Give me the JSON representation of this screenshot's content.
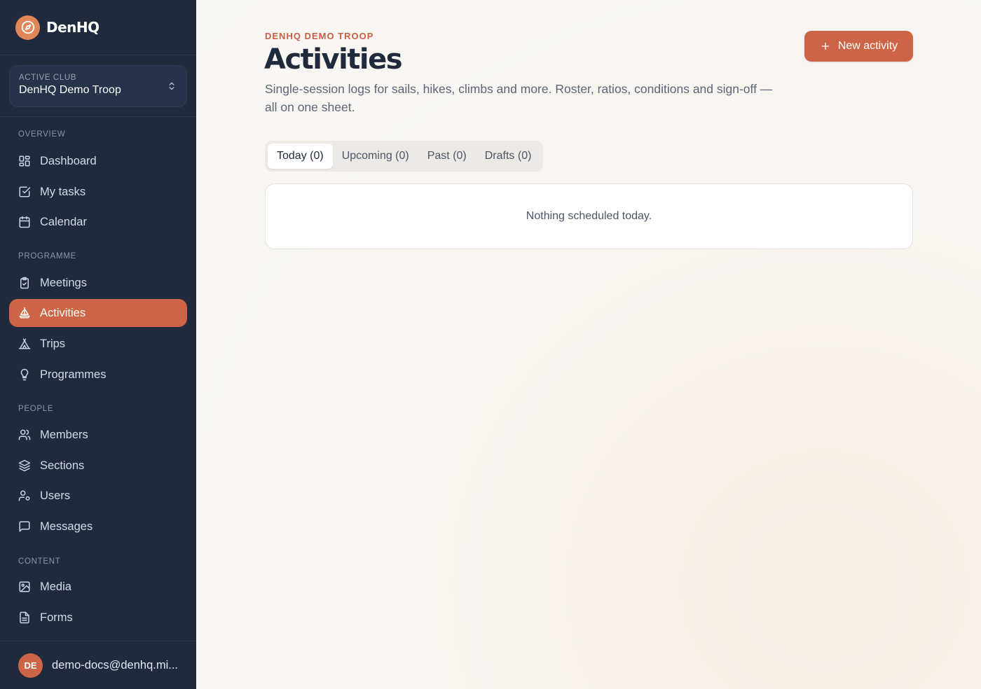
{
  "brand": {
    "name": "DenHQ",
    "logo_icon": "compass-icon",
    "accent": "#e0875a"
  },
  "club_switcher": {
    "label": "ACTIVE CLUB",
    "name": "DenHQ Demo Troop"
  },
  "sidebar": {
    "sections": [
      {
        "label": "OVERVIEW",
        "items": [
          {
            "label": "Dashboard",
            "icon": "dashboard-icon"
          },
          {
            "label": "My tasks",
            "icon": "checkbox-icon"
          },
          {
            "label": "Calendar",
            "icon": "calendar-icon"
          }
        ]
      },
      {
        "label": "PROGRAMME",
        "items": [
          {
            "label": "Meetings",
            "icon": "clipboard-check-icon"
          },
          {
            "label": "Activities",
            "icon": "sailboat-icon",
            "active": true
          },
          {
            "label": "Trips",
            "icon": "tent-icon"
          },
          {
            "label": "Programmes",
            "icon": "lightbulb-icon"
          }
        ]
      },
      {
        "label": "PEOPLE",
        "items": [
          {
            "label": "Members",
            "icon": "users-icon"
          },
          {
            "label": "Sections",
            "icon": "layers-icon"
          },
          {
            "label": "Users",
            "icon": "user-cog-icon"
          },
          {
            "label": "Messages",
            "icon": "message-square-icon"
          }
        ]
      },
      {
        "label": "CONTENT",
        "items": [
          {
            "label": "Media",
            "icon": "image-icon"
          },
          {
            "label": "Forms",
            "icon": "file-text-icon"
          }
        ]
      }
    ]
  },
  "user": {
    "initials": "DE",
    "email": "demo-docs@denhq.mi..."
  },
  "header": {
    "eyebrow": "DENHQ DEMO TROOP",
    "title": "Activities",
    "subtitle": "Single-session logs for sails, hikes, climbs and more. Roster, ratios, conditions and sign-off — all on one sheet.",
    "new_button_label": "New activity"
  },
  "tabs": [
    {
      "label": "Today (0)",
      "active": true
    },
    {
      "label": "Upcoming (0)"
    },
    {
      "label": "Past (0)"
    },
    {
      "label": "Drafts (0)"
    }
  ],
  "empty_state": {
    "message": "Nothing scheduled today."
  },
  "colors": {
    "sidebar_bg": "#1f2a3d",
    "accent": "#cd6448",
    "eyebrow": "#c95f44"
  }
}
